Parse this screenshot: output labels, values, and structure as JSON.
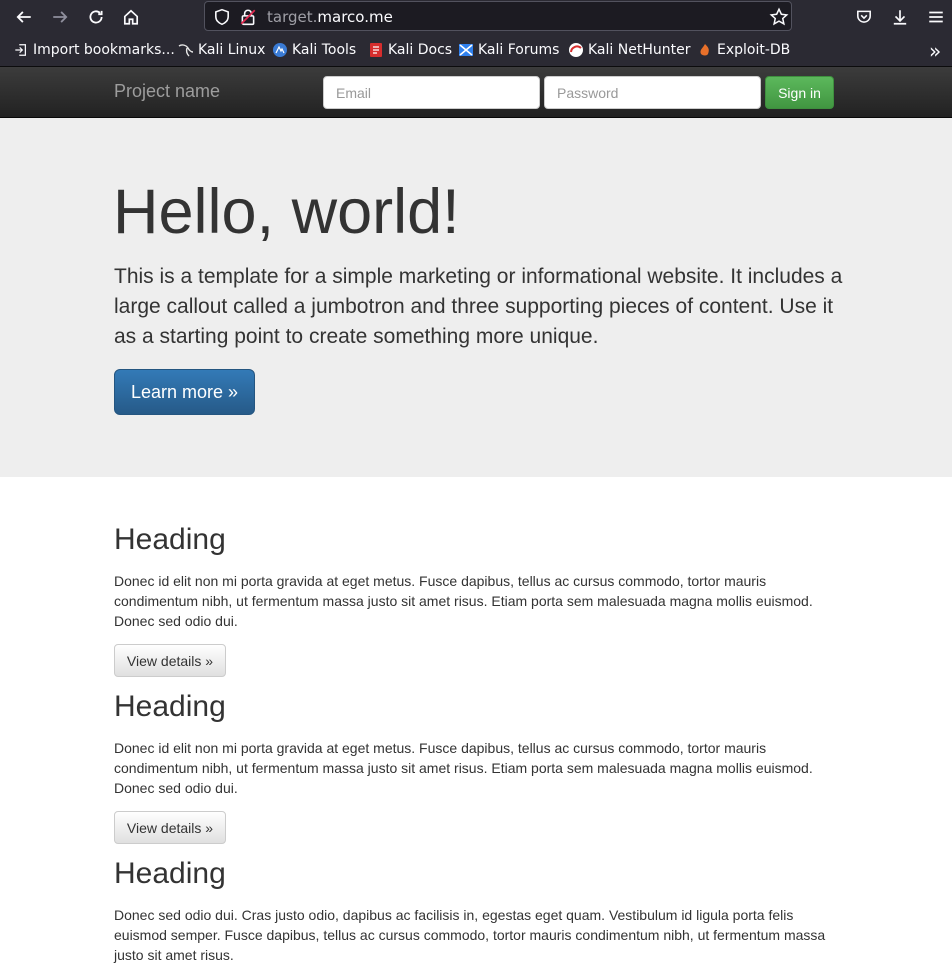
{
  "browser": {
    "url_prefix": "target.",
    "url_domain": "marco.me",
    "bookmarks": [
      {
        "label": "Import bookmarks...",
        "icon": "import-icon"
      },
      {
        "label": "Kali Linux",
        "icon": "kali-dragon-icon"
      },
      {
        "label": "Kali Tools",
        "icon": "kali-tools-icon"
      },
      {
        "label": "Kali Docs",
        "icon": "kali-docs-icon"
      },
      {
        "label": "Kali Forums",
        "icon": "kali-forums-icon"
      },
      {
        "label": "Kali NetHunter",
        "icon": "nethunter-icon"
      },
      {
        "label": "Exploit-DB",
        "icon": "exploit-db-icon"
      }
    ],
    "overflow_label": "»"
  },
  "navbar": {
    "brand": "Project name",
    "email_placeholder": "Email",
    "password_placeholder": "Password",
    "signin_label": "Sign in"
  },
  "jumbotron": {
    "title": "Hello, world!",
    "text": "This is a template for a simple marketing or informational website. It includes a large callout called a jumbotron and three supporting pieces of content. Use it as a starting point to create something more unique.",
    "button_label": "Learn more »"
  },
  "columns": [
    {
      "heading": "Heading",
      "text": "Donec id elit non mi porta gravida at eget metus. Fusce dapibus, tellus ac cursus commodo, tortor mauris condimentum nibh, ut fermentum massa justo sit amet risus. Etiam porta sem malesuada magna mollis euismod. Donec sed odio dui.",
      "button_label": "View details »"
    },
    {
      "heading": "Heading",
      "text": "Donec id elit non mi porta gravida at eget metus. Fusce dapibus, tellus ac cursus commodo, tortor mauris condimentum nibh, ut fermentum massa justo sit amet risus. Etiam porta sem malesuada magna mollis euismod. Donec sed odio dui.",
      "button_label": "View details »"
    },
    {
      "heading": "Heading",
      "text": "Donec sed odio dui. Cras justo odio, dapibus ac facilisis in, egestas eget quam. Vestibulum id ligula porta felis euismod semper. Fusce dapibus, tellus ac cursus commodo, tortor mauris condimentum nibh, ut fermentum massa justo sit amet risus."
    }
  ]
}
